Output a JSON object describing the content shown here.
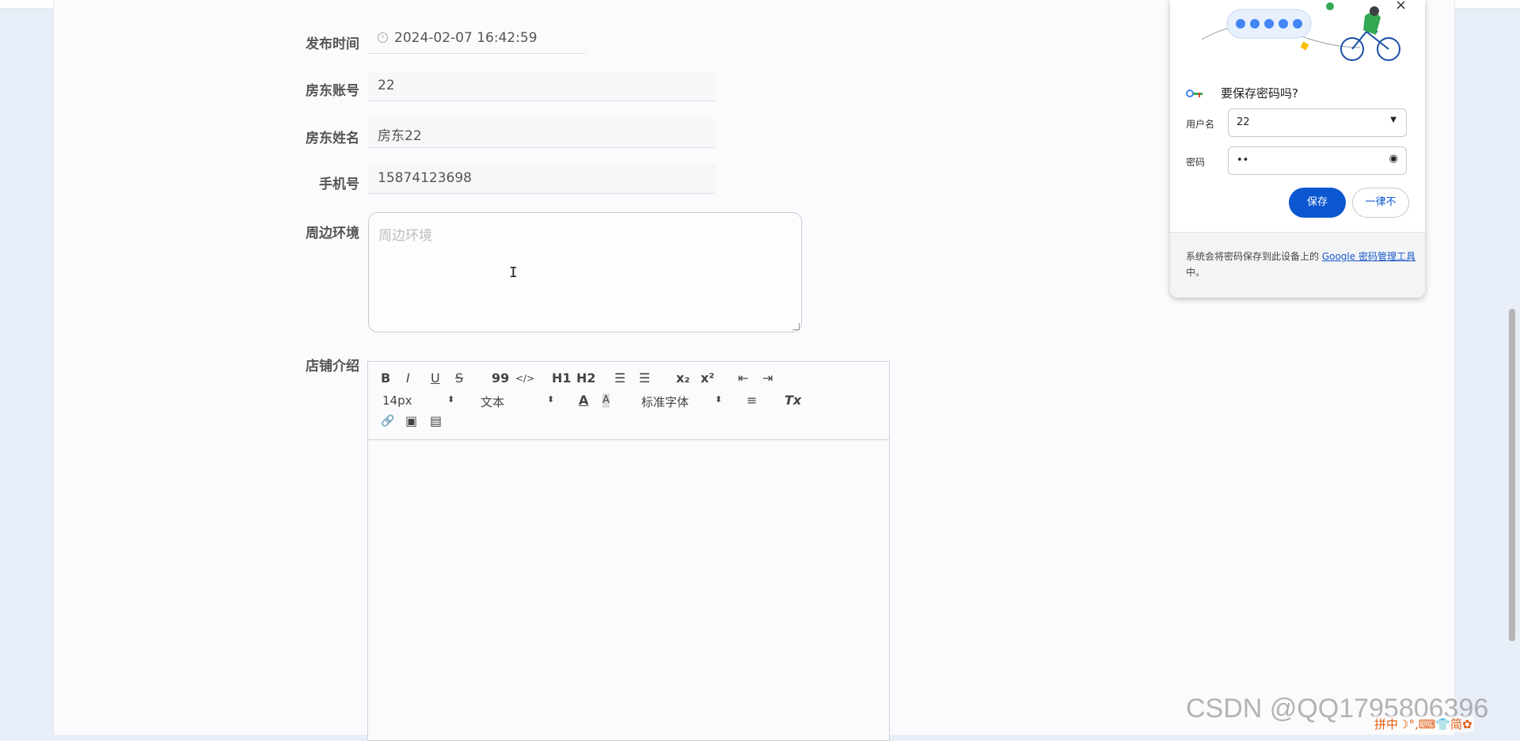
{
  "form": {
    "publish_time": {
      "label": "发布时间",
      "value": "2024-02-07 16:42:59"
    },
    "landlord_account": {
      "label": "房东账号",
      "value": "22"
    },
    "landlord_name": {
      "label": "房东姓名",
      "value": "房东22"
    },
    "phone": {
      "label": "手机号",
      "value": "15874123698"
    },
    "surroundings": {
      "label": "周边环境",
      "placeholder": "周边环境",
      "value": ""
    },
    "shop_intro": {
      "label": "店铺介绍"
    }
  },
  "editor_toolbar": {
    "bold": "B",
    "italic": "I",
    "underline": "U",
    "strike": "S",
    "quote": "99",
    "code": "</>",
    "h1": "H1",
    "h2": "H2",
    "ordered_list": "☰",
    "bullet_list": "☰",
    "subscript": "x₂",
    "superscript": "x²",
    "outdent": "⇤",
    "indent": "⇥",
    "font_size": "14px",
    "text_style": "文本",
    "font_family": "标准字体",
    "font_color": "A",
    "bg_color": "A",
    "align": "≡",
    "clear_format": "Tx",
    "link": "🔗",
    "image": "▣",
    "video": "▤"
  },
  "password_popup": {
    "title": "要保存密码吗?",
    "username_label": "用户名",
    "username_value": "22",
    "password_label": "密码",
    "password_value": "••",
    "save_button": "保存",
    "never_button": "一律不",
    "footer_text_before": "系统会将密码保存到此设备上的 ",
    "footer_link": "Google 密码管理工具",
    "footer_text_after": "中。",
    "close_symbol": "×"
  },
  "watermark": "CSDN @QQ1795806396",
  "ime_toolbar": "拼中☽°,⌨👕简✿"
}
